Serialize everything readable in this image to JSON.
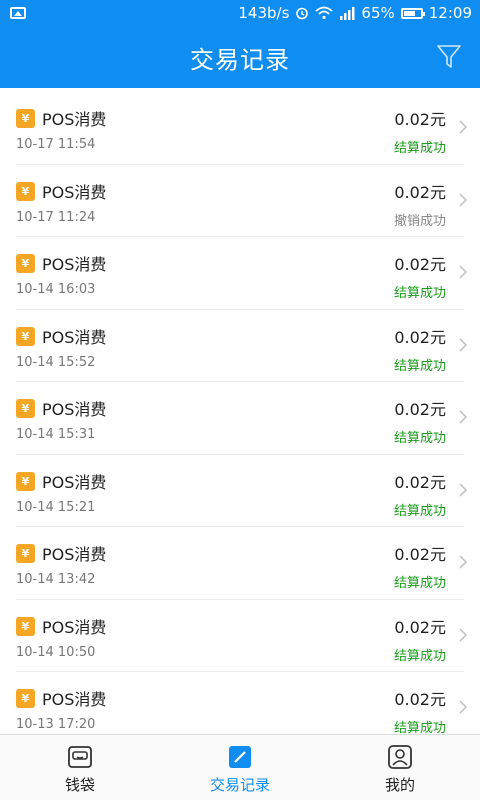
{
  "status_bar": {
    "speed": "143b/s",
    "battery": "65%",
    "time": "12:09"
  },
  "header": {
    "title": "交易记录"
  },
  "transactions": [
    {
      "title": "POS消费",
      "time": "10-17 11:54",
      "amount": "0.02元",
      "status": "结算成功",
      "status_type": "success"
    },
    {
      "title": "POS消费",
      "time": "10-17 11:24",
      "amount": "0.02元",
      "status": "撤销成功",
      "status_type": "cancel"
    },
    {
      "title": "POS消费",
      "time": "10-14 16:03",
      "amount": "0.02元",
      "status": "结算成功",
      "status_type": "success"
    },
    {
      "title": "POS消费",
      "time": "10-14 15:52",
      "amount": "0.02元",
      "status": "结算成功",
      "status_type": "success"
    },
    {
      "title": "POS消费",
      "time": "10-14 15:31",
      "amount": "0.02元",
      "status": "结算成功",
      "status_type": "success"
    },
    {
      "title": "POS消费",
      "time": "10-14 15:21",
      "amount": "0.02元",
      "status": "结算成功",
      "status_type": "success"
    },
    {
      "title": "POS消费",
      "time": "10-14 13:42",
      "amount": "0.02元",
      "status": "结算成功",
      "status_type": "success"
    },
    {
      "title": "POS消费",
      "time": "10-14 10:50",
      "amount": "0.02元",
      "status": "结算成功",
      "status_type": "success"
    },
    {
      "title": "POS消费",
      "time": "10-13 17:20",
      "amount": "0.02元",
      "status": "结算成功",
      "status_type": "success"
    }
  ],
  "yen_symbol": "¥",
  "bottom_nav": {
    "wallet_label": "钱袋",
    "records_label": "交易记录",
    "mine_label": "我的"
  },
  "colors": {
    "primary": "#0f8df0",
    "success": "#1a9c1a",
    "badge": "#f5a623"
  }
}
